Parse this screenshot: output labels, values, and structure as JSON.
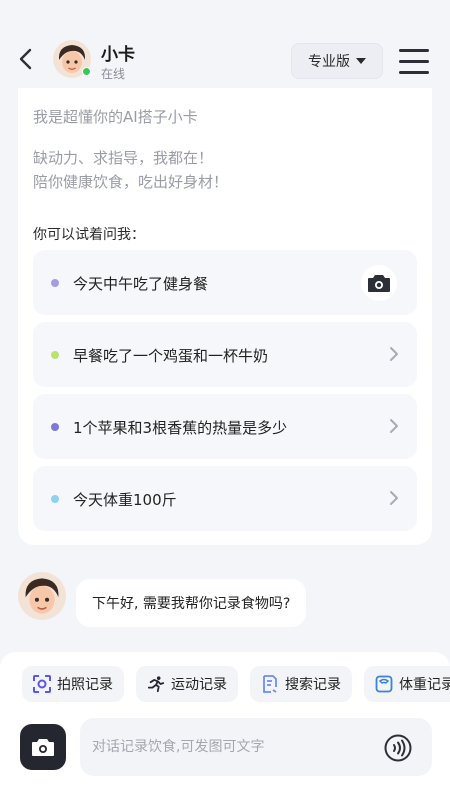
{
  "header": {
    "bot_name": "小卡",
    "status": "在线",
    "plan_label": "专业版"
  },
  "intro": {
    "line1": "我是超懂你的AI搭子小卡",
    "line2": "缺动力、求指导，我都在！",
    "line3": "陪你健康饮食，吃出好身材！",
    "try_label": "你可以试着问我："
  },
  "suggestions": [
    {
      "text": "今天中午吃了健身餐",
      "dot_color": "#a79be6",
      "action_icon": "camera-icon"
    },
    {
      "text": "早餐吃了一个鸡蛋和一杯牛奶",
      "dot_color": "#b7e36e",
      "action_icon": "chevron-right-icon"
    },
    {
      "text": "1个苹果和3根香蕉的热量是多少",
      "dot_color": "#7a78d8",
      "action_icon": "chevron-right-icon"
    },
    {
      "text": "今天体重100斤",
      "dot_color": "#8fd0f5",
      "action_icon": "chevron-right-icon"
    }
  ],
  "chat": {
    "message": "下午好, 需要我帮你记录食物吗?"
  },
  "quick_actions": [
    {
      "label": "拍照记录",
      "icon": "photo-scan-icon",
      "color": "#5b55e8"
    },
    {
      "label": "运动记录",
      "icon": "running-icon",
      "color": "#24272f"
    },
    {
      "label": "搜索记录",
      "icon": "document-search-icon",
      "color": "#6e8cf5"
    },
    {
      "label": "体重记录",
      "icon": "scale-icon",
      "color": "#3c82d6"
    }
  ],
  "input": {
    "placeholder": "对话记录饮食,可发图可文字"
  },
  "colors": {
    "accent": "#5b55e8",
    "online": "#37c85a",
    "background": "#f4f5f9"
  }
}
